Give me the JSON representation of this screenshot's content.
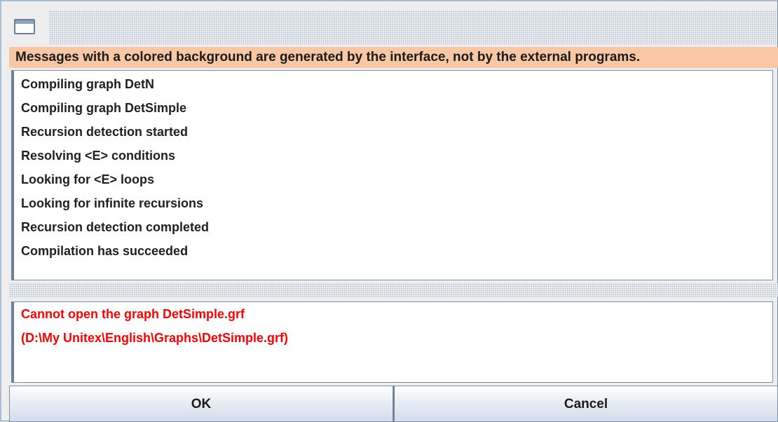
{
  "window": {
    "icon": "window-icon"
  },
  "banner": {
    "text": "Messages with a colored background are generated by the interface, not by the external programs.",
    "background_color": "#f8c8a4"
  },
  "log_messages": [
    "Compiling graph DetN",
    "Compiling graph DetSimple",
    "Recursion detection started",
    "Resolving <E> conditions",
    "Looking for <E> loops",
    "Looking for infinite recursions",
    "Recursion detection completed",
    "Compilation has succeeded"
  ],
  "error_messages": [
    "Cannot open the graph DetSimple.grf",
    "(D:\\My Unitex\\English\\Graphs\\DetSimple.grf)"
  ],
  "error_color": "#ff0000",
  "buttons": {
    "ok_label": "OK",
    "cancel_label": "Cancel"
  }
}
